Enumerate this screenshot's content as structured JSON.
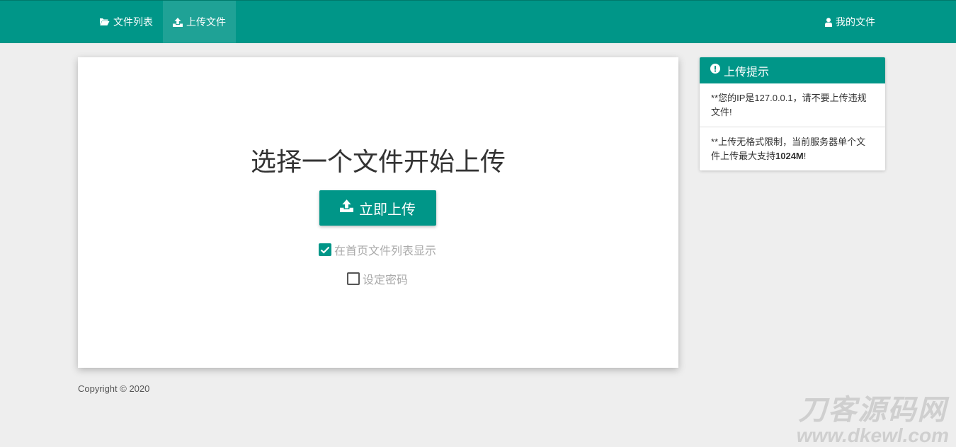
{
  "nav": {
    "file_list_label": "文件列表",
    "upload_label": "上传文件",
    "my_files_label": "我的文件"
  },
  "main": {
    "title": "选择一个文件开始上传",
    "upload_button_label": "立即上传",
    "show_on_homepage_label": "在首页文件列表显示",
    "show_on_homepage_checked": true,
    "set_password_label": "设定密码",
    "set_password_checked": false
  },
  "tips": {
    "header": "上传提示",
    "tip1_prefix": "**您的IP是",
    "tip1_ip": "127.0.0.1",
    "tip1_suffix": "，请不要上传违规文件!",
    "tip2_prefix": "**上传无格式限制，当前服务器单个文件上传最大支持",
    "tip2_size": "1024M",
    "tip2_suffix": "!"
  },
  "footer": {
    "copyright": "Copyright © 2020"
  },
  "watermark": {
    "cn": "刀客源码网",
    "en": "www.dkewl.com"
  },
  "colors": {
    "primary": "#009688",
    "background": "#eeeeee"
  },
  "icons": {
    "file_list": "folder-open-icon",
    "upload": "upload-icon",
    "my_files": "user-icon",
    "tips": "exclamation-circle-icon"
  }
}
